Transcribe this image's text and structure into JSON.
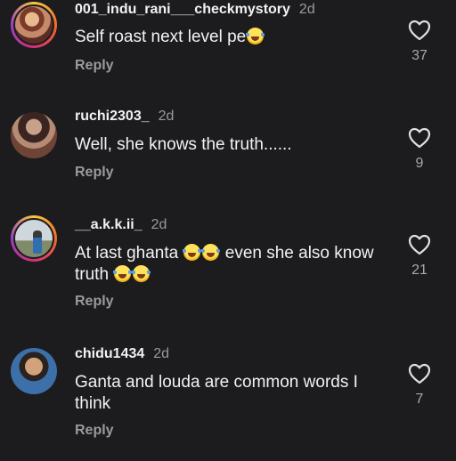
{
  "comments": [
    {
      "username": "001_indu_rani___checkmystory",
      "time": "2d",
      "text_parts": [
        "Self roast next level pe",
        "",
        ""
      ],
      "reply_label": "Reply",
      "likes": "37",
      "avatar_ring": true
    },
    {
      "username": "ruchi2303_",
      "time": "2d",
      "text_parts": [
        "Well, she knows the truth......",
        "",
        ""
      ],
      "reply_label": "Reply",
      "likes": "9",
      "avatar_ring": false
    },
    {
      "username": "__a.k.k.ii_",
      "time": "2d",
      "text_parts": [
        "At last ghanta ",
        " even she also know truth ",
        ""
      ],
      "reply_label": "Reply",
      "likes": "21",
      "avatar_ring": true
    },
    {
      "username": "chidu1434",
      "time": "2d",
      "text_parts": [
        "Ganta and louda are common words I think",
        "",
        ""
      ],
      "reply_label": "Reply",
      "likes": "7",
      "avatar_ring": false
    }
  ],
  "icons": {
    "like": "heart-outline-icon",
    "emoji": "face-with-tears-of-joy"
  },
  "colors": {
    "background": "#1c1c1e",
    "text": "#f2f2f2",
    "muted": "#9a9a9a"
  }
}
